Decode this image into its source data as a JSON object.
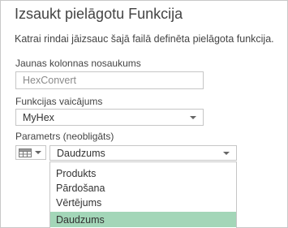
{
  "dialog": {
    "title": "Izsaukt pielāgotu  Funkcija",
    "description": "Katrai rindai jāizsauc šajā failā definēta pielāgota funkcija."
  },
  "column_name": {
    "label": "Jaunas kolonnas nosaukums",
    "value": "HexConvert"
  },
  "function_query": {
    "label": "Funkcijas vaicājums",
    "selected": "MyHex"
  },
  "parameter": {
    "label": "Parametrs (neobligāts)",
    "type_icon": "table-icon",
    "selected": "Daudzums",
    "options": [
      "Produkts",
      "Pārdošana",
      "Vērtējums",
      "Daudzums"
    ],
    "highlighted_option": "Daudzums",
    "highlight_color": "#a3d6b8"
  }
}
